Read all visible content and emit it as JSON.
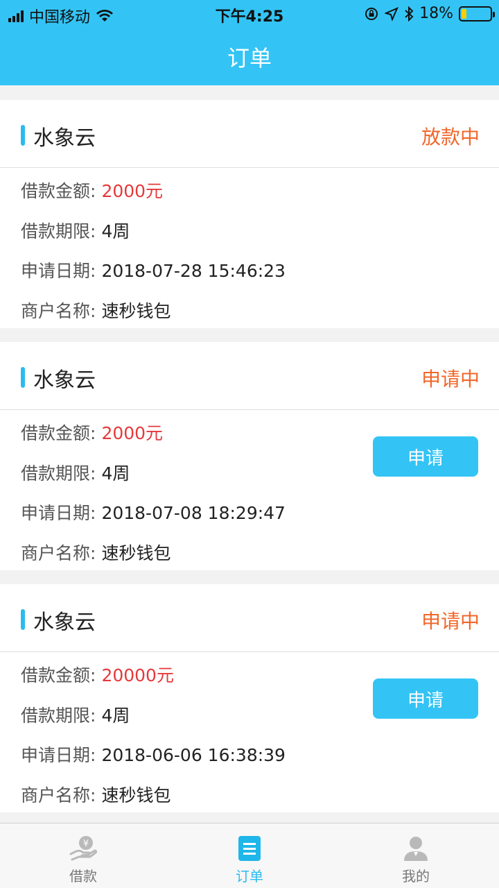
{
  "status_bar": {
    "carrier": "中国移动",
    "time": "下午4:25",
    "battery": "18%"
  },
  "nav": {
    "title": "订单"
  },
  "orders": [
    {
      "name": "水象云",
      "status": "放款中",
      "amount_label": "借款金额:",
      "amount": "2000元",
      "term_label": "借款期限:",
      "term": "4周",
      "date_label": "申请日期:",
      "date": "2018-07-28 15:46:23",
      "merchant_label": "商户名称:",
      "merchant": "速秒钱包"
    },
    {
      "name": "水象云",
      "status": "申请中",
      "amount_label": "借款金额:",
      "amount": "2000元",
      "term_label": "借款期限:",
      "term": "4周",
      "date_label": "申请日期:",
      "date": "2018-07-08 18:29:47",
      "merchant_label": "商户名称:",
      "merchant": "速秒钱包",
      "button": "申请"
    },
    {
      "name": "水象云",
      "status": "申请中",
      "amount_label": "借款金额:",
      "amount": "20000元",
      "term_label": "借款期限:",
      "term": "4周",
      "date_label": "申请日期:",
      "date": "2018-06-06 16:38:39",
      "merchant_label": "商户名称:",
      "merchant": "速秒钱包",
      "button": "申请"
    }
  ],
  "tabbar": {
    "items": [
      {
        "label": "借款",
        "icon": "loan-icon"
      },
      {
        "label": "订单",
        "icon": "order-list-icon",
        "active": true
      },
      {
        "label": "我的",
        "icon": "user-icon"
      }
    ]
  },
  "colors": {
    "accent": "#33c4f5",
    "status_orange": "#f0672a",
    "amount_red": "#e6393b"
  }
}
